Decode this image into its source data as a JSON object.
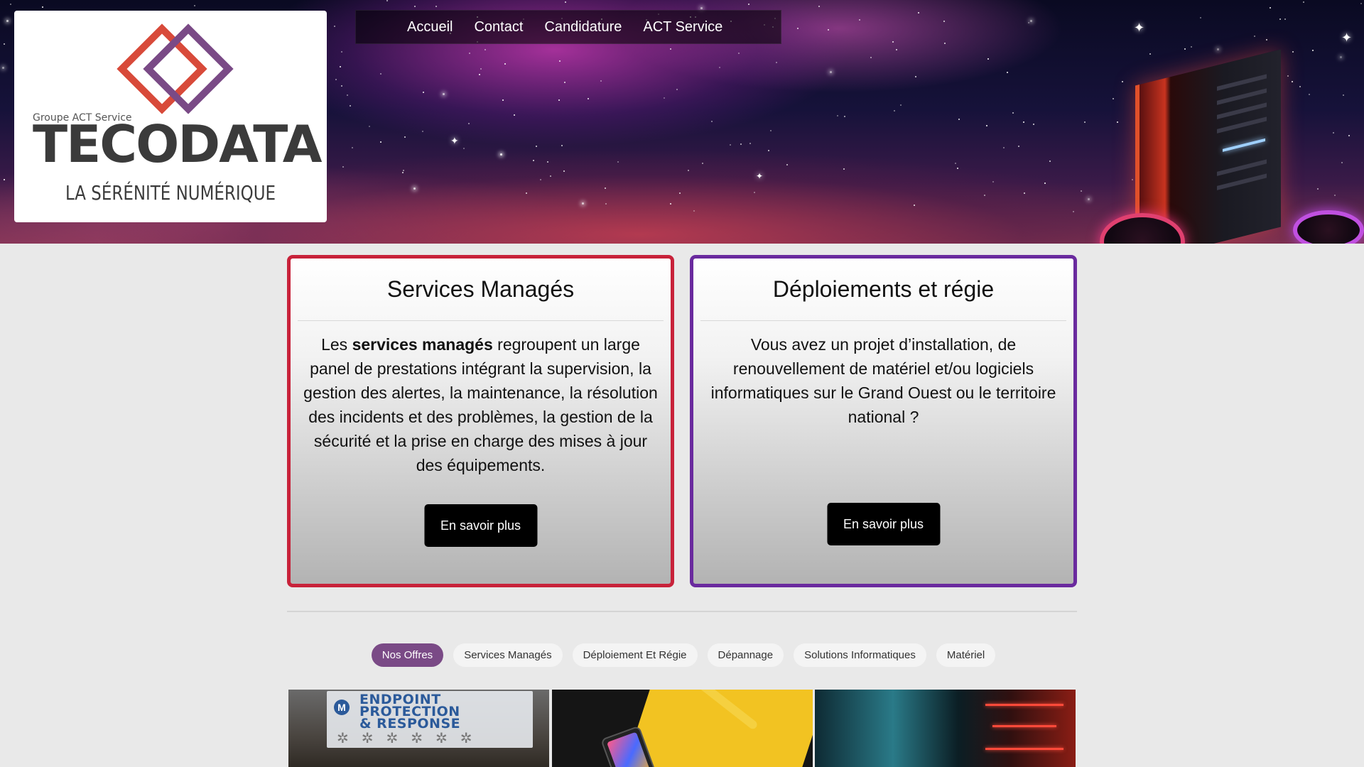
{
  "logo": {
    "group": "Groupe ACT Service",
    "name": "TECODATA",
    "tagline": "LA SÉRÉNITÉ NUMÉRIQUE"
  },
  "nav": {
    "items": [
      "Accueil",
      "Contact",
      "Candidature",
      "ACT Service"
    ]
  },
  "cards": [
    {
      "title": "Services Managés",
      "text_before": "Les ",
      "text_bold": "services managés",
      "text_after": " regroupent un large panel de prestations intégrant la supervision, la gestion des alertes, la maintenance, la résolution des incidents et des problèmes, la gestion de la sécurité et la prise en charge des mises à jour des équipements.",
      "button": "En savoir plus",
      "border_color": "#c8223a"
    },
    {
      "title": "Déploiements et régie",
      "text": "Vous avez un projet d’installation, de renouvellement de matériel et/ou logiciels informatiques sur le Grand Ouest ou le territoire national ?",
      "button": "En savoir plus",
      "border_color": "#6a2a9e"
    }
  ],
  "filter_tabs": {
    "items": [
      "Nos Offres",
      "Services Managés",
      "Déploiement Et Régie",
      "Dépannage",
      "Solutions Informatiques",
      "Matériel"
    ],
    "active": "Nos Offres",
    "active_color": "#7a4a86"
  },
  "gallery": {
    "thumb1_text_line1": "ENDPOINT PROTECTION",
    "thumb1_text_line2": "& RESPONSE"
  }
}
